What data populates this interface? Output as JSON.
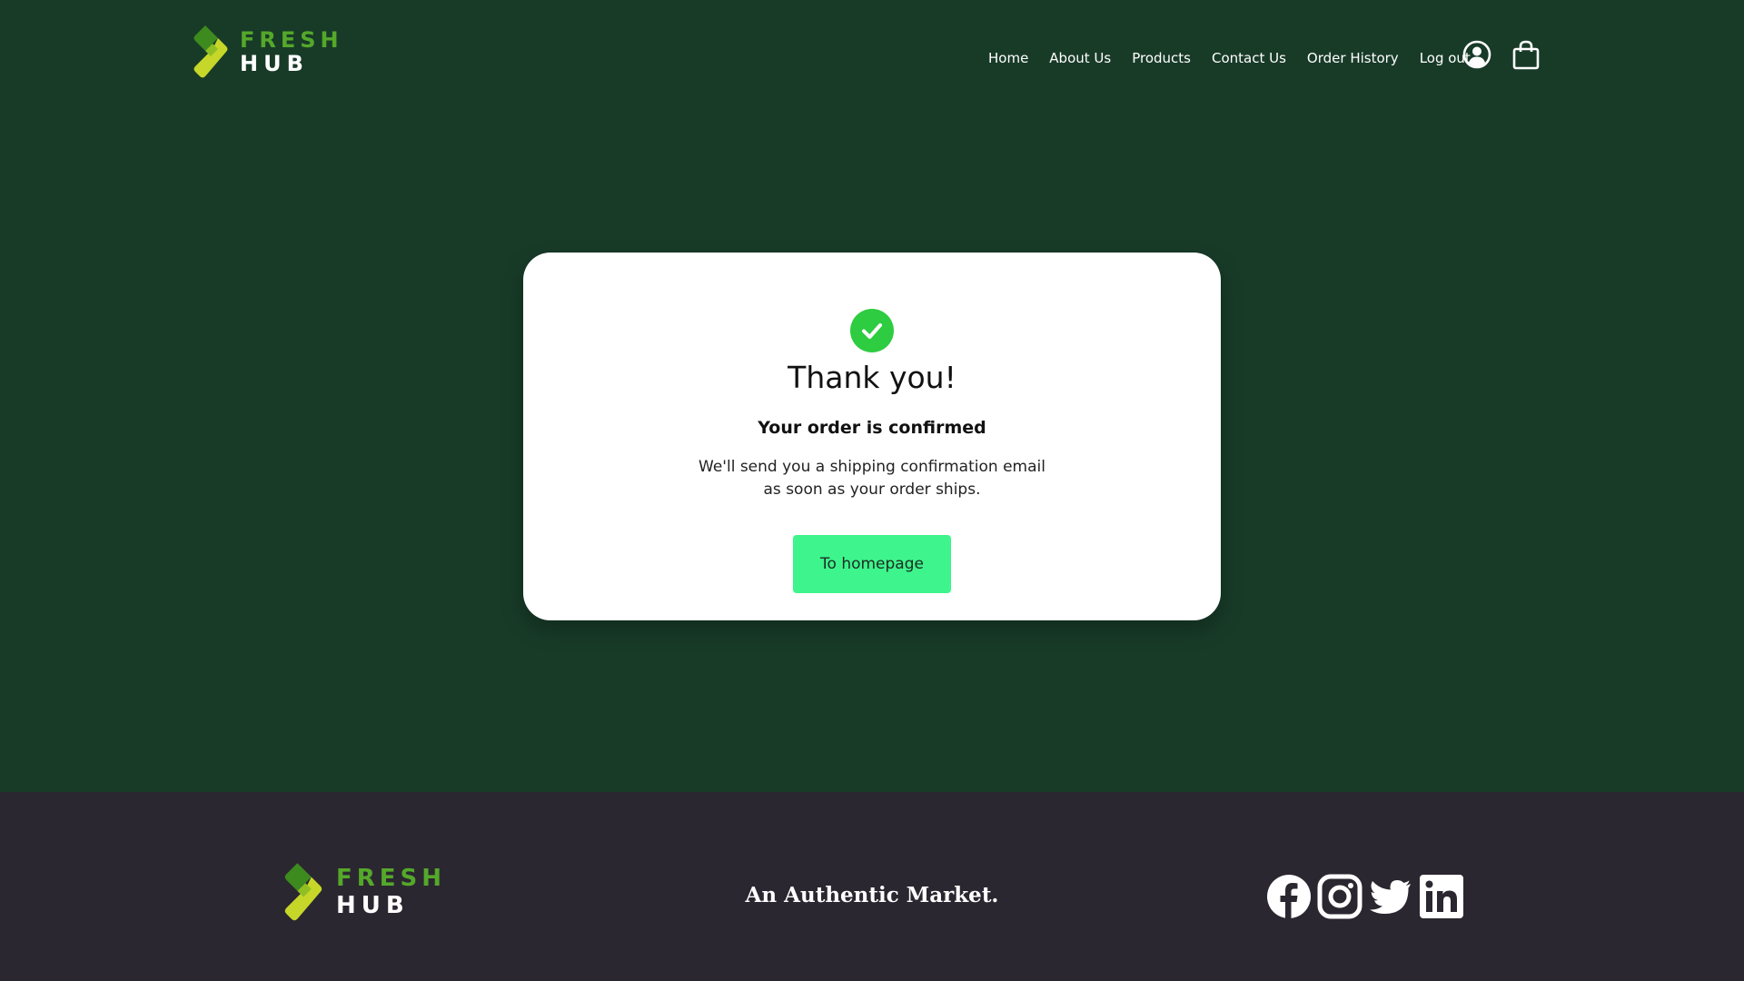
{
  "brand": {
    "line1": "FRESH",
    "line2": "HUB",
    "colors": {
      "green": "#54a82a",
      "lime": "#c6d72a",
      "dark_green": "#3d8a1f"
    }
  },
  "nav": {
    "links": [
      "Home",
      "About Us",
      "Products",
      "Contact Us",
      "Order History",
      "Log out"
    ],
    "icons": [
      "user-circle-icon",
      "shopping-bag-icon"
    ]
  },
  "confirmation": {
    "icon": "check-circle-icon",
    "title": "Thank you!",
    "subtitle": "Your order is confirmed",
    "message_line1": "We'll send you a shipping confirmation email",
    "message_line2": "as soon as your order ships.",
    "button_label": "To homepage"
  },
  "footer": {
    "tagline": "An Authentic Market.",
    "social_icons": [
      "facebook-icon",
      "instagram-icon",
      "twitter-icon",
      "linkedin-icon"
    ]
  },
  "colors": {
    "page_background": "#183b28",
    "footer_background": "#2b2730",
    "card_background": "#ffffff",
    "success_green": "#2ecc40",
    "button_green": "#3df58c"
  }
}
